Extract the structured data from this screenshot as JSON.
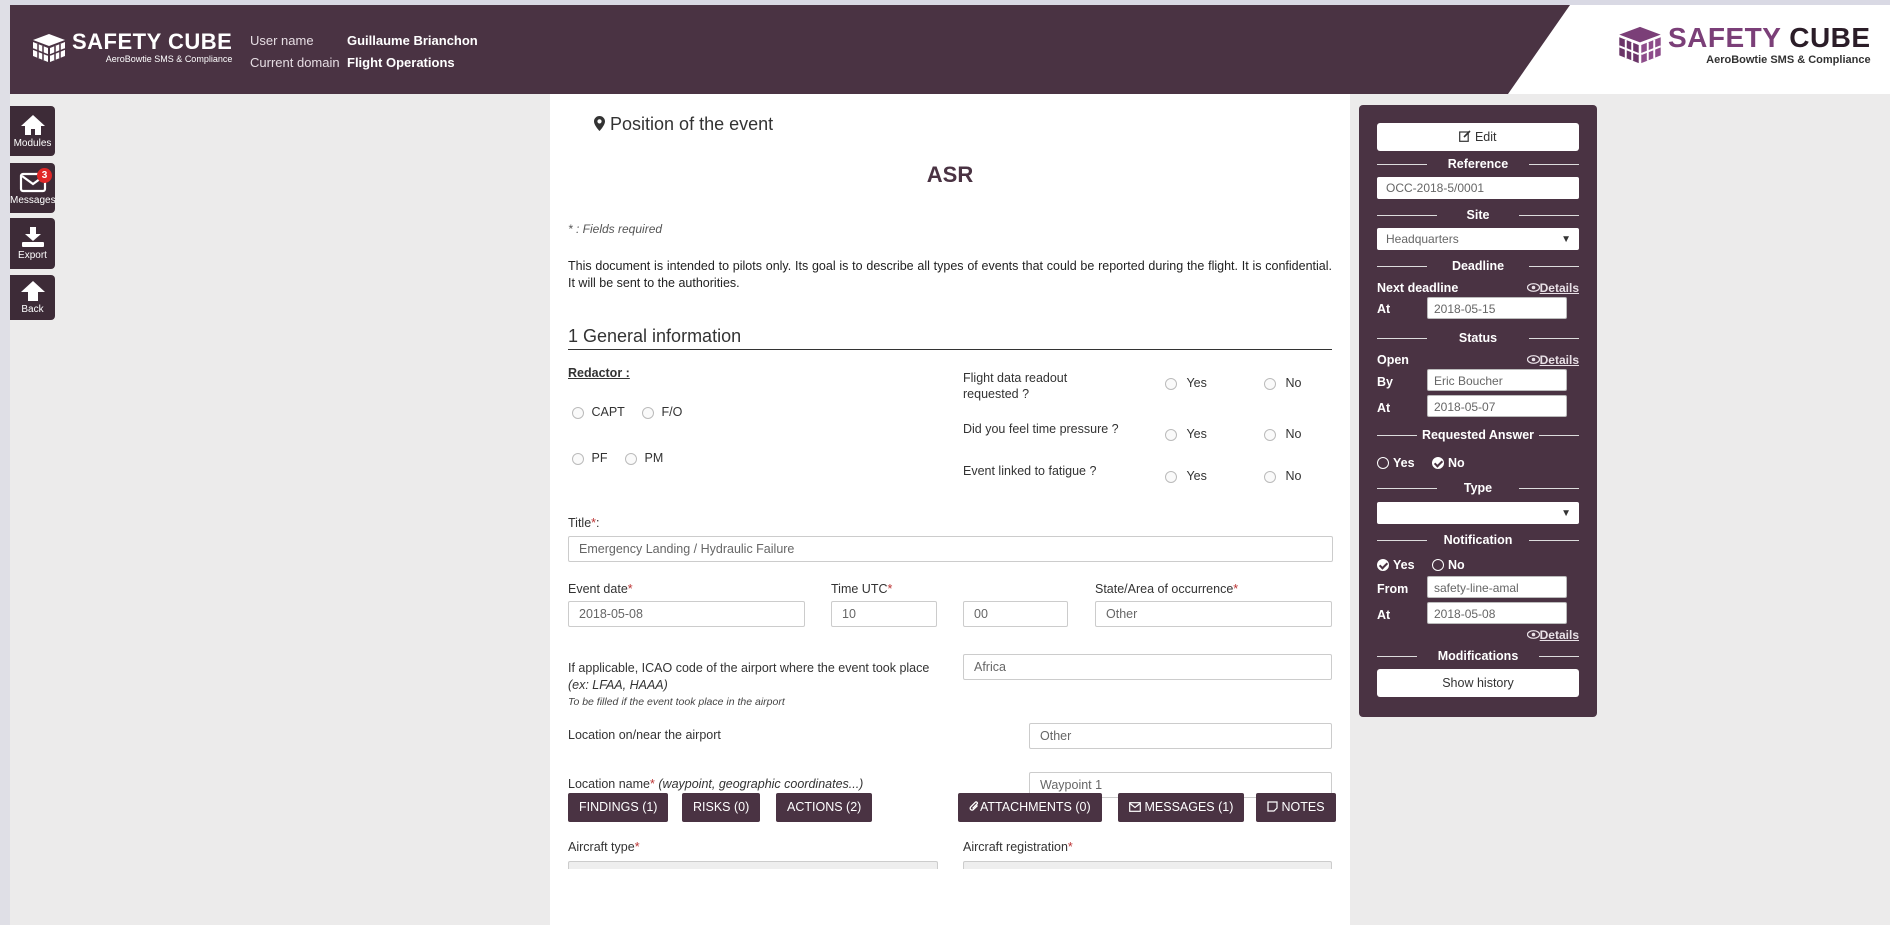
{
  "header": {
    "logo_brand": "SAFETY CUBE",
    "logo_brand_a": "SAFETY",
    "logo_brand_b": "CUBE",
    "logo_tagline": "AeroBowtie SMS & Compliance",
    "user_label": "User name",
    "user_value": "Guillaume Brianchon",
    "domain_label": "Current domain",
    "domain_value": "Flight Operations"
  },
  "sidebar": {
    "modules": "Modules",
    "messages": "Messages",
    "messages_badge": "3",
    "export": "Export",
    "back": "Back"
  },
  "form": {
    "position_title": "Position of the event",
    "doc_title": "ASR",
    "fields_required": "* : Fields required",
    "description": "This document is intended to pilots only. Its goal is to describe all types of events that could be reported during the flight. It is confidential. It will be sent to the authorities.",
    "section_title": "1 General information",
    "redactor_label": "Redactor :",
    "redactor_options": [
      "CAPT",
      "F/O",
      "PF",
      "PM"
    ],
    "q_flight_data": "Flight data readout requested ?",
    "q_time_pressure": "Did you feel time pressure ?",
    "q_fatigue": "Event linked to fatigue ?",
    "yes": "Yes",
    "no": "No",
    "title_label": "Title",
    "title_value": "Emergency Landing / Hydraulic Failure",
    "event_date_label": "Event date",
    "event_date_value": "2018-05-08",
    "time_utc_label": "Time UTC",
    "time_hour": "10",
    "time_min": "00",
    "state_label": "State/Area of occurrence",
    "state_value": "Other",
    "icao_label": "If applicable, ICAO code of the airport where the event took place",
    "icao_example": "(ex: LFAA, HAAA)",
    "icao_note": "To be filled if the event took place in the airport",
    "icao_value": "Africa",
    "location_near_label": "Location on/near the airport",
    "location_near_value": "Other",
    "location_name_label": "Location name",
    "location_name_hint": "(waypoint, geographic coordinates...)",
    "location_name_value": "Waypoint 1",
    "aircraft_type_label": "Aircraft type",
    "aircraft_reg_label": "Aircraft registration",
    "required_mark": "*"
  },
  "bottom_buttons": {
    "findings": "FINDINGS (1)",
    "risks": "RISKS (0)",
    "actions": "ACTIONS (2)",
    "attachments": "ATTACHMENTS (0)",
    "messages": "MESSAGES (1)",
    "notes": "NOTES"
  },
  "panel": {
    "edit": "Edit",
    "reference_label": "Reference",
    "reference_value": "OCC-2018-5/0001",
    "site_label": "Site",
    "site_value": "Headquarters",
    "deadline_label": "Deadline",
    "next_deadline": "Next deadline",
    "details": "Details",
    "at": "At",
    "deadline_at": "2018-05-15",
    "status_label": "Status",
    "status_value": "Open",
    "by": "By",
    "status_by": "Eric Boucher",
    "status_at": "2018-05-07",
    "requested_answer_label": "Requested Answer",
    "yes": "Yes",
    "no": "No",
    "type_label": "Type",
    "type_value": "",
    "notification_label": "Notification",
    "from": "From",
    "notif_from": "safety-line-amal",
    "notif_at": "2018-05-08",
    "modifications_label": "Modifications",
    "show_history": "Show history"
  }
}
